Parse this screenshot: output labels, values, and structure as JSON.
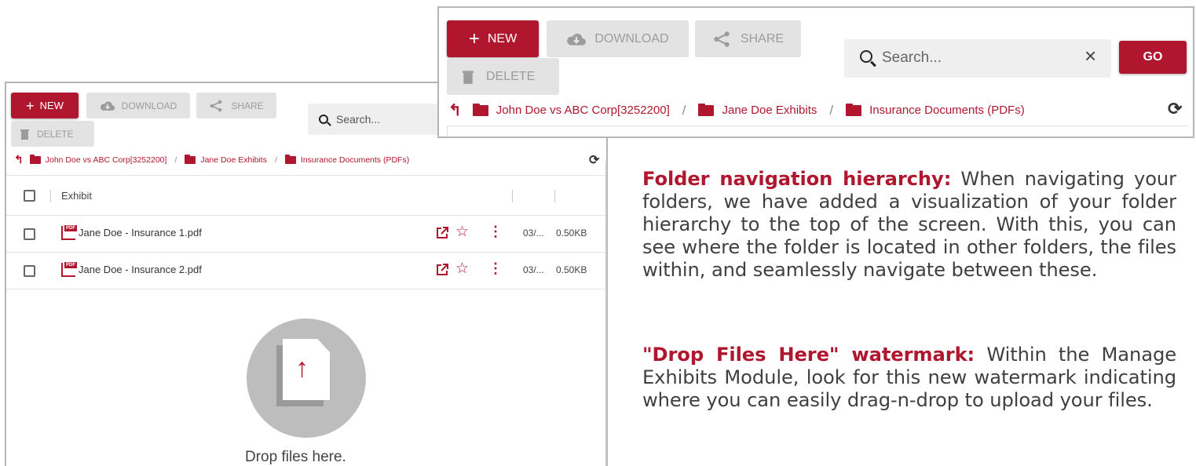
{
  "toolbar": {
    "new_label": "NEW",
    "download_label": "DOWNLOAD",
    "share_label": "SHARE",
    "delete_label": "DELETE",
    "go_label": "GO"
  },
  "search": {
    "placeholder": "Search...",
    "small_placeholder": "Search..."
  },
  "breadcrumb": {
    "items": [
      "John Doe vs ABC Corp[3252200]",
      "Jane Doe Exhibits",
      "Insurance Documents (PDFs)"
    ],
    "separator": "/"
  },
  "table": {
    "header_exhibit": "Exhibit",
    "rows": [
      {
        "name": "Jane Doe - Insurance 1.pdf",
        "date": "03/...",
        "size": "0.50KB",
        "badge": "PDF"
      },
      {
        "name": "Jane Doe - Insurance 2.pdf",
        "date": "03/...",
        "size": "0.50KB",
        "badge": "PDF"
      }
    ]
  },
  "dropzone": {
    "label": "Drop files here."
  },
  "notes": [
    {
      "title": "Folder navigation hierarchy:",
      "body": "When navigating your folders, we have added a visualization of your folder hierarchy to the top of the screen. With this, you can see where the folder is located in other folders, the files within, and seamlessly navigate between these."
    },
    {
      "title": "\"Drop Files Here\" watermark:",
      "body": "Within the Manage Exhibits Module,  look for this new watermark indicating where you can easily drag-n-drop to upload your files."
    }
  ],
  "colors": {
    "accent": "#b0172f",
    "button_gray": "#e3e3e3",
    "text": "#404040"
  },
  "icons": [
    "plus-icon",
    "cloud-download-icon",
    "share-icon",
    "trash-icon",
    "search-icon",
    "close-icon",
    "refresh-icon",
    "up-arrow-icon",
    "folder-icon",
    "pdf-icon",
    "open-external-icon",
    "star-icon",
    "more-vert-icon",
    "upload-arrow-icon"
  ]
}
